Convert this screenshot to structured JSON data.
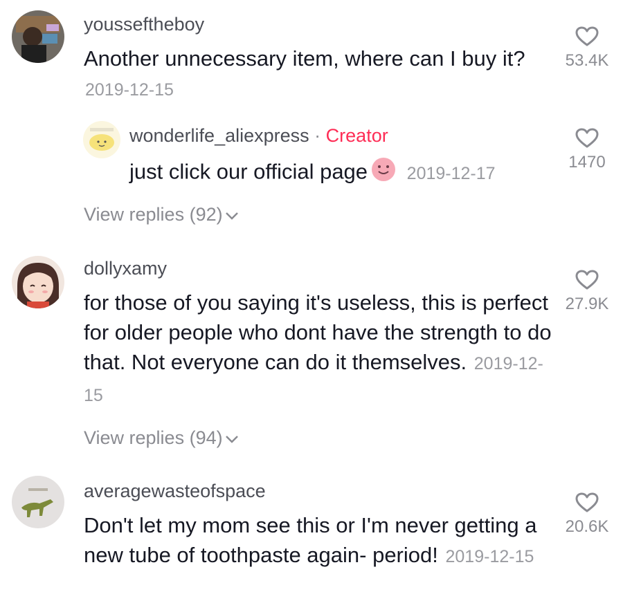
{
  "comments": [
    {
      "username": "youssef‌theboy",
      "text": "Another unnecessary item, where can I buy it?",
      "date": "2019-12-15",
      "likes": "53.4K",
      "reply": {
        "username": "wonderlife_aliexpress",
        "separator": "·",
        "badge": "Creator",
        "text": "just click our official page",
        "emoji": "smiling-face-emoji",
        "date": "2019-12-17",
        "likes": "1470"
      },
      "view_replies": "View replies (92)"
    },
    {
      "username": "dollyxamy",
      "text": "for those of you saying it's useless, this is perfect for older people who dont have the strength to do that. Not everyone can do it themselves.",
      "date": "2019-12-15",
      "likes": "27.9K",
      "view_replies": "View replies (94)"
    },
    {
      "username": "averagewasteofspace",
      "text": "Don't let my mom see this or I'm never getting a new tube of toothpaste again- period!",
      "date": "2019-12-15",
      "likes": "20.6K"
    }
  ],
  "colors": {
    "creator": "#fe2c55",
    "meta": "#8a8b91",
    "text": "#161823"
  },
  "icons": {
    "like": "heart-outline-icon",
    "expand": "chevron-down-icon"
  }
}
